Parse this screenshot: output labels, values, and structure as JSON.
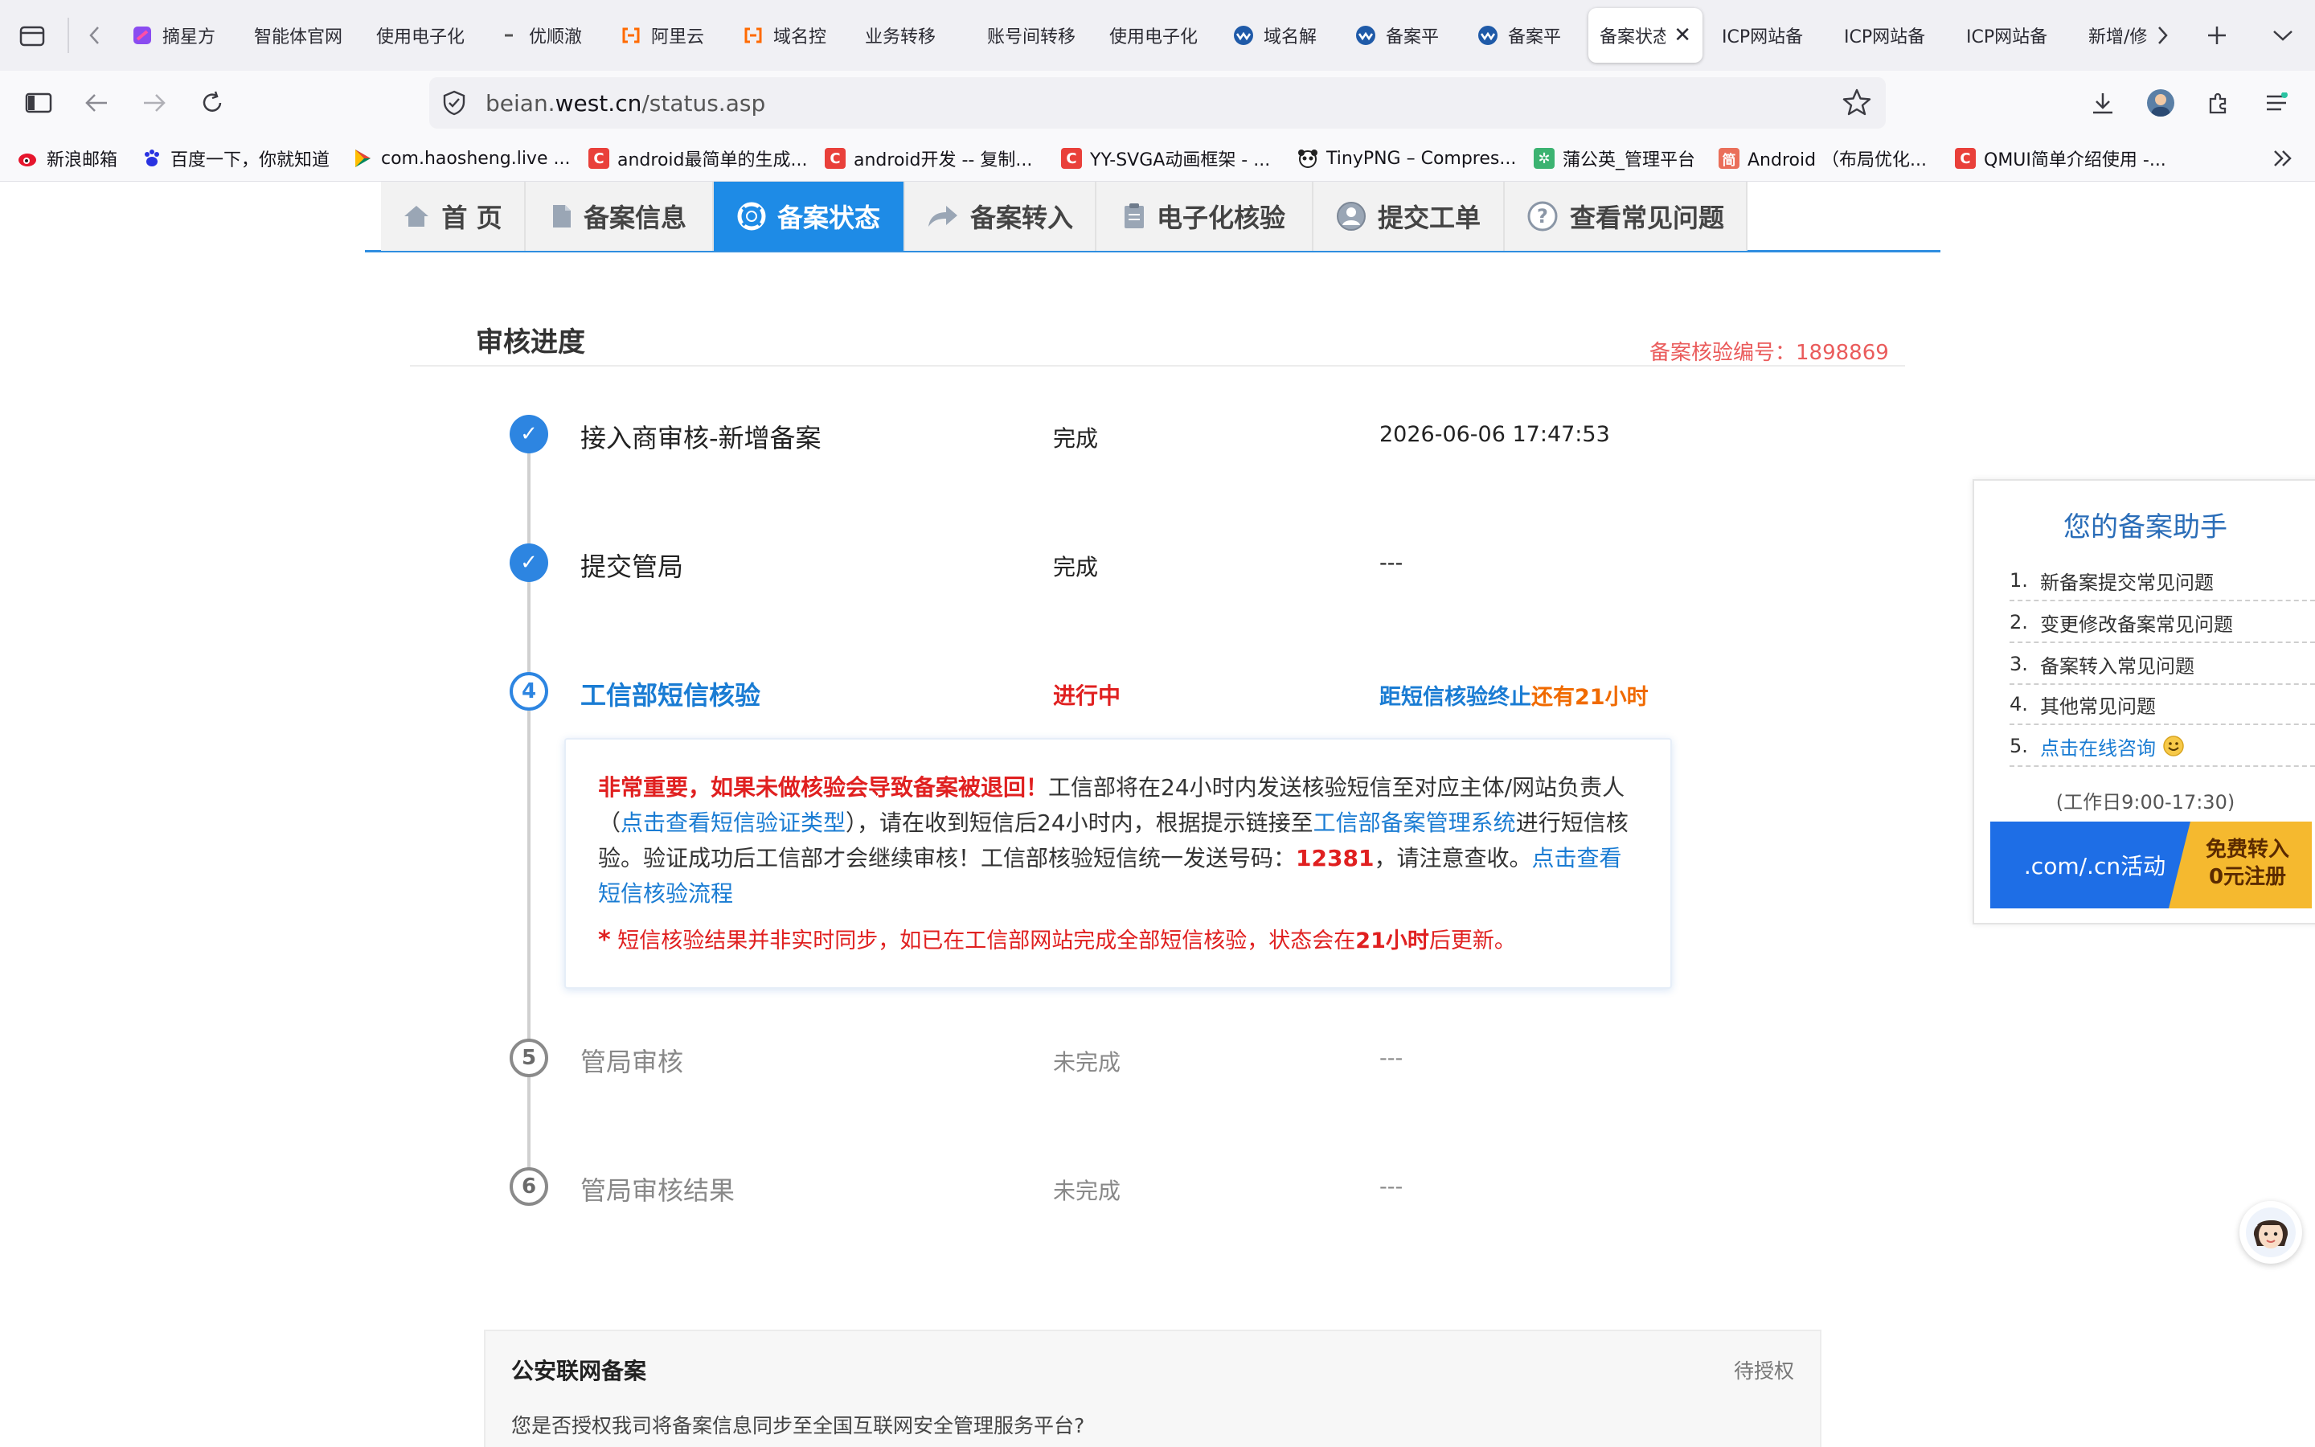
{
  "browser": {
    "tabs": [
      {
        "label": "摘星方"
      },
      {
        "label": "智能体官网"
      },
      {
        "label": "使用电子化"
      },
      {
        "label": "优顺澈"
      },
      {
        "label": "阿里云"
      },
      {
        "label": "域名控"
      },
      {
        "label": "业务转移"
      },
      {
        "label": "账号间转移"
      },
      {
        "label": "使用电子化"
      },
      {
        "label": "域名解"
      },
      {
        "label": "备案平"
      },
      {
        "label": "备案平"
      },
      {
        "label": "备案状态"
      },
      {
        "label": "ICP网站备"
      },
      {
        "label": "ICP网站备"
      },
      {
        "label": "ICP网站备"
      },
      {
        "label": "新增/修"
      }
    ],
    "url_host": "beian.west.cn",
    "url_path": "/status.asp",
    "url_prefix": "beian.",
    "url_domain": "west.cn",
    "bookmarks": [
      {
        "label": "新浪邮箱"
      },
      {
        "label": "百度一下，你就知道"
      },
      {
        "label": "com.haosheng.live ..."
      },
      {
        "label": "android最简单的生成..."
      },
      {
        "label": "android开发 -- 复制..."
      },
      {
        "label": "YY-SVGA动画框架 - ..."
      },
      {
        "label": "TinyPNG – Compres..."
      },
      {
        "label": "蒲公英_管理平台"
      },
      {
        "label": "Android （布局优化..."
      },
      {
        "label": "QMUI简单介绍使用 -..."
      }
    ]
  },
  "nav": {
    "items": [
      {
        "label": "首 页"
      },
      {
        "label": "备案信息"
      },
      {
        "label": "备案状态"
      },
      {
        "label": "备案转入"
      },
      {
        "label": "电子化核验"
      },
      {
        "label": "提交工单"
      },
      {
        "label": "查看常见问题"
      }
    ]
  },
  "progress": {
    "title": "审核进度",
    "verify_label": "备案核验编号：",
    "verify_no": "1898869",
    "steps": [
      {
        "icon": "✓",
        "name": "接入商审核-新增备案",
        "status": "完成",
        "time": "2026-06-06 17:47:53"
      },
      {
        "icon": "✓",
        "name": "提交管局",
        "status": "完成",
        "time": "---"
      },
      {
        "icon": "4",
        "name": "工信部短信核验",
        "status": "进行中",
        "time_prefix": "距短信核验终止",
        "time_suffix": "还有21小时"
      },
      {
        "icon": "5",
        "name": "管局审核",
        "status": "未完成",
        "time": "---"
      },
      {
        "icon": "6",
        "name": "管局审核结果",
        "status": "未完成",
        "time": "---"
      }
    ],
    "notice": {
      "warn": "非常重要，如果未做核验会导致备案被退回！",
      "t1": "工信部将在24小时内发送核验短信至对应主体/网站负责人（",
      "link1": "点击查看短信验证类型",
      "t2": "），请在收到短信后24小时内，根据提示链接至",
      "link2": "工信部备案管理系统",
      "t3": "进行短信核验。验证成功后工信部才会继续审核！工信部核验短信统一发送号码：",
      "phone": "12381",
      "t4": "，请注意查收。",
      "link3": "点击查看短信核验流程",
      "star": "*",
      "n1": " 短信核验结果并非实时同步，如已在工信部网站完成全部短信核验，状态会在",
      "hours": "21小时",
      "n2": "后更新。"
    }
  },
  "assistant": {
    "title": "您的备案助手",
    "items": [
      {
        "num": "1.",
        "label": "新备案提交常见问题"
      },
      {
        "num": "2.",
        "label": "变更修改备案常见问题"
      },
      {
        "num": "3.",
        "label": "备案转入常见问题"
      },
      {
        "num": "4.",
        "label": "其他常见问题"
      },
      {
        "num": "5.",
        "label": "点击在线咨询"
      }
    ],
    "hours": "(工作日9:00-17:30)",
    "promo_left": ".com/.cn活动",
    "promo_right_1": "免费转入",
    "promo_right_2": "0元注册"
  },
  "police": {
    "title": "公安联网备案",
    "status": "待授权",
    "question": "您是否授权我司将备案信息同步至全国互联网安全管理服务平台?"
  },
  "colors": {
    "accent": "#1e8be6",
    "warning": "#e02020",
    "countdown": "#f06a00"
  }
}
